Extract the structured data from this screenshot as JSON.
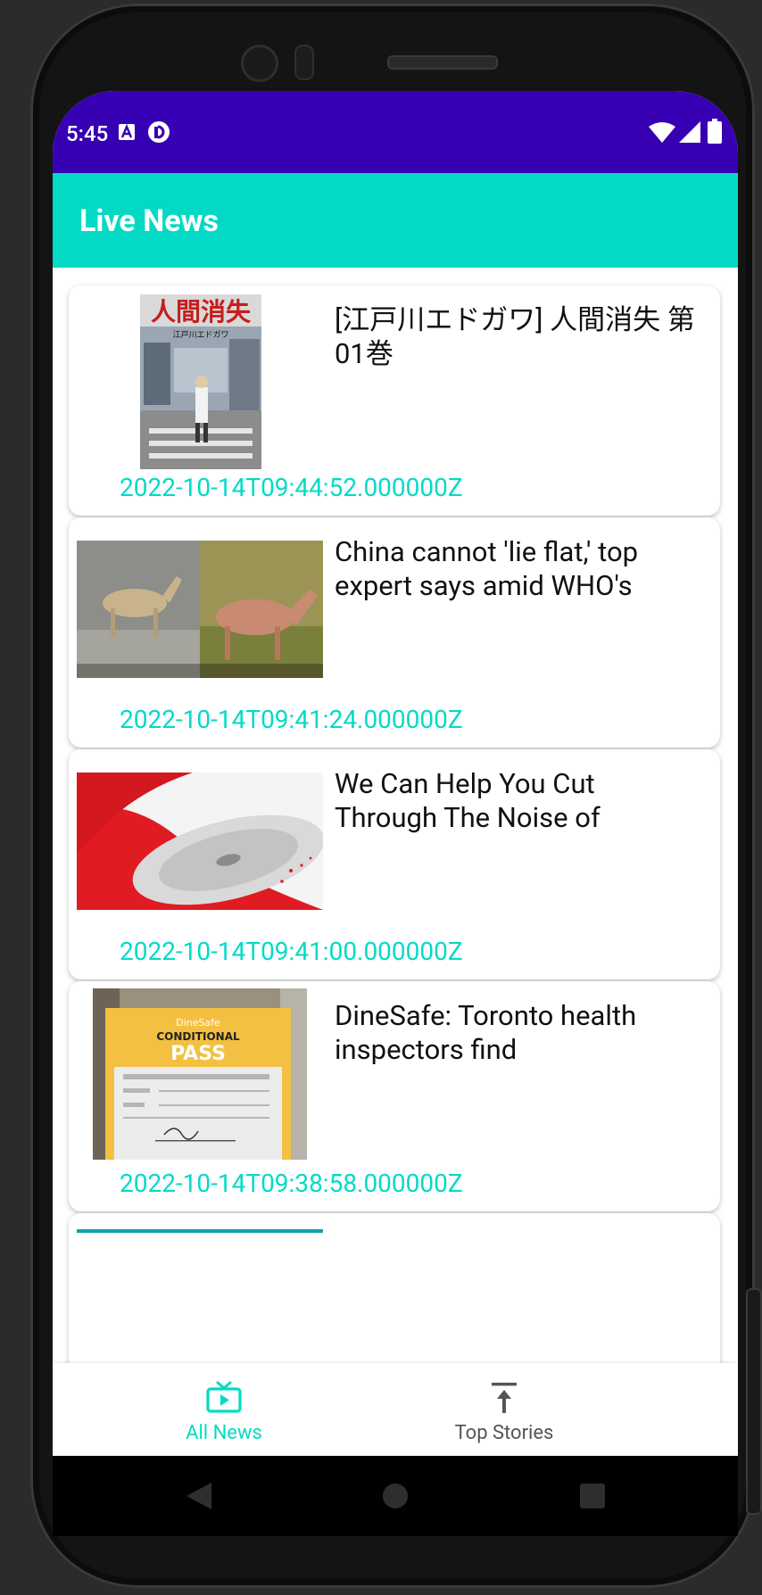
{
  "status_bar": {
    "time": "5:45",
    "left_icons": [
      "a-notification-icon",
      "sync-notification-icon"
    ],
    "right_icons": [
      "wifi-icon",
      "cellular-signal-icon",
      "battery-icon"
    ],
    "color": "#3700b3"
  },
  "app_bar": {
    "title": "Live News",
    "color": "#03dac5"
  },
  "articles": [
    {
      "headline": "[江戸川エドガワ] 人間消失 第01巻",
      "timestamp": "2022-10-14T09:44:52.000000Z",
      "image": "manga-cover-image"
    },
    {
      "headline": "China cannot 'lie flat,' top expert says amid WHO's",
      "timestamp": "2022-10-14T09:41:24.000000Z",
      "image": "animals-image"
    },
    {
      "headline": "We Can Help You Cut Through The Noise of",
      "timestamp": "2022-10-14T09:41:00.000000Z",
      "image": "saw-blade-image"
    },
    {
      "headline": "DineSafe: Toronto health inspectors find",
      "timestamp": "2022-10-14T09:38:58.000000Z",
      "image": "dinesafe-pass-image"
    }
  ],
  "dinesafe_sign": {
    "brand": "DineSafe",
    "line1": "CONDITIONAL",
    "line2": "PASS"
  },
  "manga_cover": {
    "title": "人間消失",
    "author": "江戸川エドガワ"
  },
  "bottom_nav": {
    "items": [
      {
        "label": "All News",
        "icon": "tv-play-icon",
        "selected": true
      },
      {
        "label": "Top Stories",
        "icon": "arrow-up-to-line-icon",
        "selected": false
      }
    ],
    "active_color": "#03dac5",
    "inactive_color": "#666666"
  },
  "system_nav": {
    "buttons": [
      "back-icon",
      "home-icon",
      "recents-icon"
    ]
  }
}
